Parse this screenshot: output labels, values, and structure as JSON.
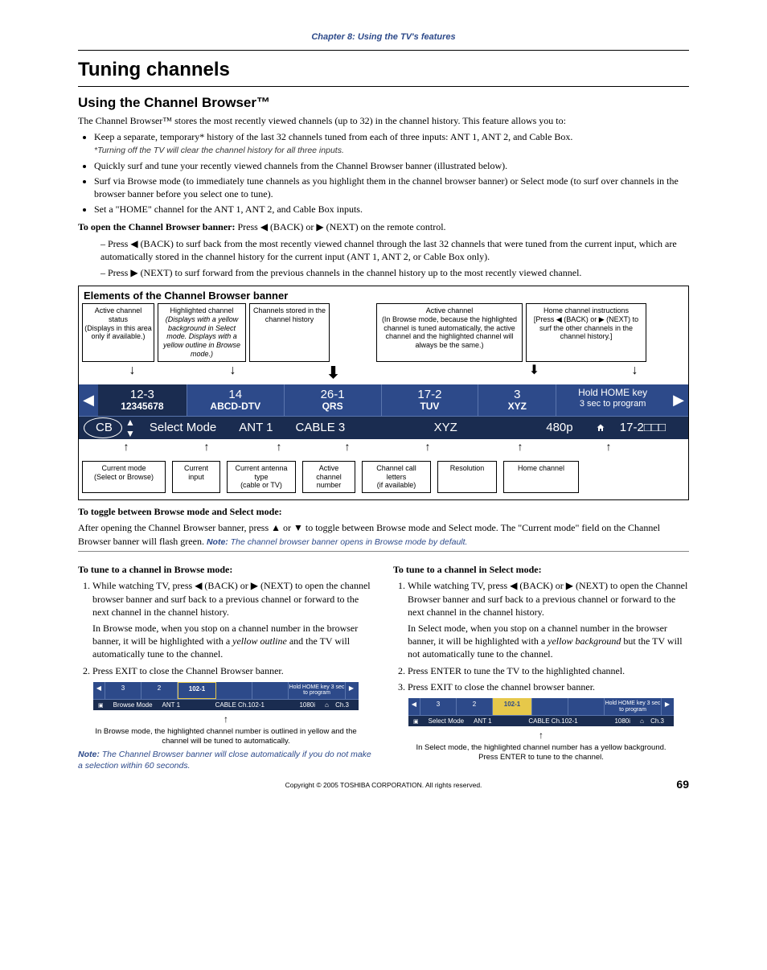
{
  "chapter_title": "Chapter 8: Using the TV's features",
  "h1": "Tuning channels",
  "h2": "Using the Channel Browser™",
  "intro_p": "The Channel Browser™ stores the most recently viewed channels (up to 32) in the channel history. This feature allows you to:",
  "bullets": [
    "Keep a separate, temporary* history of the last 32 channels tuned from each of three inputs: ANT 1, ANT 2, and Cable Box.",
    "Quickly surf and tune your recently viewed channels from the Channel Browser banner (illustrated below).",
    "Surf via Browse mode (to immediately tune channels as you highlight them in the channel browser banner) or Select mode (to surf over channels in the browser banner before you select one to tune).",
    "Set a \"HOME\" channel for the ANT 1, ANT 2, and Cable Box inputs."
  ],
  "bullet1_note": "*Turning off the TV will clear the channel history for all three inputs.",
  "open_banner_lead": "To open the Channel Browser banner:",
  "open_banner_rest": " Press ◀ (BACK) or ▶ (NEXT) on the remote control.",
  "dash1": "Press ◀ (BACK) to surf back from the most recently viewed channel through the last 32 channels that were tuned from the current input, which are automatically stored in the channel history for the current input (ANT 1, ANT 2, or Cable Box only).",
  "dash2": "Press ▶ (NEXT) to surf forward from the previous channels in the channel history up to the most recently viewed channel.",
  "elements_title": "Elements of the Channel Browser banner",
  "top_callouts": {
    "c1": {
      "l1": "Active channel status",
      "l2": "(Displays in this area only if available.)"
    },
    "c2": {
      "l1": "Highlighted channel",
      "l2": "(Displays with a yellow background in Select mode. Displays with a yellow outline in Browse mode.)"
    },
    "c3": {
      "l1": "Channels stored in the channel history"
    },
    "c4": {
      "l1": "Active channel",
      "l2": "(In Browse mode, because the highlighted channel is tuned automatically, the active channel and the highlighted channel will always be the same.)"
    },
    "c5": {
      "l1": "Home channel instructions",
      "l2": "[Press ◀ (BACK) or ▶ (NEXT) to surf the other channels in the channel history.]"
    }
  },
  "banner": {
    "cells": [
      {
        "top": "12-3",
        "bot": "12345678"
      },
      {
        "top": "14",
        "bot": "ABCD-DTV"
      },
      {
        "top": "26-1",
        "bot": "QRS"
      },
      {
        "top": "17-2",
        "bot": "TUV"
      },
      {
        "top": "3",
        "bot": "XYZ"
      },
      {
        "top": "Hold HOME key",
        "bot": "3 sec to program"
      }
    ],
    "bottom": {
      "mode": "Select Mode",
      "input": "ANT 1",
      "ant": "CABLE 3",
      "ch": "XYZ",
      "res": "480p",
      "home": "17-2□□□"
    }
  },
  "bottom_callouts": [
    {
      "l1": "Current mode",
      "l2": "(Select or Browse)"
    },
    {
      "l1": "Current input"
    },
    {
      "l1": "Current antenna type",
      "l2": "(cable or TV)"
    },
    {
      "l1": "Active channel number"
    },
    {
      "l1": "Channel call letters",
      "l2": "(if available)"
    },
    {
      "l1": "Resolution"
    },
    {
      "l1": "Home channel"
    }
  ],
  "toggle_head": "To toggle between Browse mode and Select mode:",
  "toggle_p": "After opening the Channel Browser banner, press ▲ or ▼ to toggle between Browse mode and Select mode.  The \"Current mode\" field on the Channel Browser banner will flash green.  ",
  "toggle_note_label": "Note:",
  "toggle_note": " The channel browser banner opens in Browse mode by default.",
  "left_col": {
    "head": "To tune to a channel in Browse mode:",
    "li1": "While watching TV, press ◀ (BACK) or ▶ (NEXT) to open the channel browser banner and surf back to a previous channel or forward to the next channel in the channel history.",
    "li1b": "In Browse mode, when you stop on a channel number in the browser banner, it will be highlighted with a ",
    "li1b_em": "yellow outline",
    "li1b_end": " and the TV will automatically tune to the channel.",
    "li2": "Press EXIT to close the Channel Browser banner.",
    "caption": "In Browse mode, the highlighted channel number is outlined in yellow and the channel will be tuned to automatically.",
    "note_label": "Note:",
    "note": " The Channel Browser banner will close automatically if you do not make a selection within 60 seconds."
  },
  "right_col": {
    "head": "To tune to a channel in Select mode:",
    "li1": "While watching TV, press ◀ (BACK) or ▶ (NEXT) to open the Channel Browser banner and surf back to a previous channel or forward to the next channel in the channel history.",
    "li1b": "In Select mode, when you stop on a channel number in the browser banner, it will be highlighted with a ",
    "li1b_em": "yellow background",
    "li1b_end": " but the TV will not automatically tune to the channel.",
    "li2": "Press ENTER to tune the TV to the highlighted channel.",
    "li3": "Press EXIT to close the channel browser banner.",
    "caption": "In Select mode, the highlighted channel number has a yellow background. Press ENTER to tune to the channel."
  },
  "mini": {
    "cells": [
      "3",
      "2",
      "102-1",
      "",
      "",
      "Hold HOME key\n3 sec to program"
    ],
    "bot": {
      "mode_b": "Browse Mode",
      "mode_s": "Select Mode",
      "inp": "ANT 1",
      "mid": "CABLE  Ch.102-1",
      "res": "1080i",
      "home": "Ch.3"
    }
  },
  "footer": "Copyright © 2005 TOSHIBA CORPORATION. All rights reserved.",
  "page_num": "69"
}
